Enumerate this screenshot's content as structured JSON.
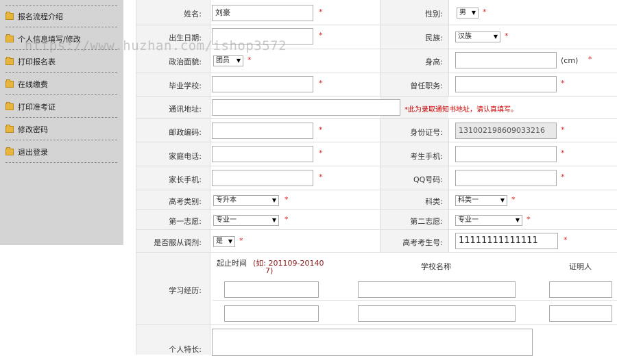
{
  "sidebar": {
    "items": [
      {
        "label": "报名流程介绍"
      },
      {
        "label": "个人信息填写/修改"
      },
      {
        "label": "打印报名表"
      },
      {
        "label": "在线缴费"
      },
      {
        "label": "打印准考证"
      },
      {
        "label": "修改密码"
      },
      {
        "label": "退出登录"
      }
    ]
  },
  "form": {
    "name": {
      "label": "姓名:",
      "value": "刘豪"
    },
    "gender": {
      "label": "性别:",
      "value": "男"
    },
    "birthdate": {
      "label": "出生日期:",
      "value": ""
    },
    "ethnicity": {
      "label": "民族:",
      "value": "汉族"
    },
    "political": {
      "label": "政治面貌:",
      "value": "团员"
    },
    "height": {
      "label": "身高:",
      "value": "",
      "unit": "(cm)"
    },
    "school": {
      "label": "毕业学校:",
      "value": ""
    },
    "position": {
      "label": "曾任职务:",
      "value": ""
    },
    "address": {
      "label": "通讯地址:",
      "value": "",
      "note": "*此为录取通知书地址，请认真填写。"
    },
    "postcode": {
      "label": "邮政编码:",
      "value": ""
    },
    "id_number": {
      "label": "身份证号:",
      "value": "131002198609033216"
    },
    "home_phone": {
      "label": "家庭电话:",
      "value": ""
    },
    "mobile": {
      "label": "考生手机:",
      "value": ""
    },
    "parent_mobile": {
      "label": "家长手机:",
      "value": ""
    },
    "qq": {
      "label": "QQ号码:",
      "value": ""
    },
    "exam_type": {
      "label": "高考类别:",
      "value": "专升本"
    },
    "subject": {
      "label": "科类:",
      "value": "科类一"
    },
    "first_choice": {
      "label": "第一志愿:",
      "value": "专业一"
    },
    "second_choice": {
      "label": "第二志愿:",
      "value": "专业一"
    },
    "adjust": {
      "label": "是否服从调剂:",
      "value": "是"
    },
    "exam_number": {
      "label": "高考考生号:",
      "value": "11111111111111"
    },
    "study": {
      "label": "学习经历:",
      "col_time": "起止时间",
      "col_time_hint_1": "(如: 201109-20140",
      "col_time_hint_2": "7)",
      "col_school": "学校名称",
      "col_witness": "证明人"
    },
    "specialty": {
      "label": "个人特长:"
    },
    "required_mark": "*"
  },
  "watermark": "https://www.huzhan.com/ishop3572"
}
